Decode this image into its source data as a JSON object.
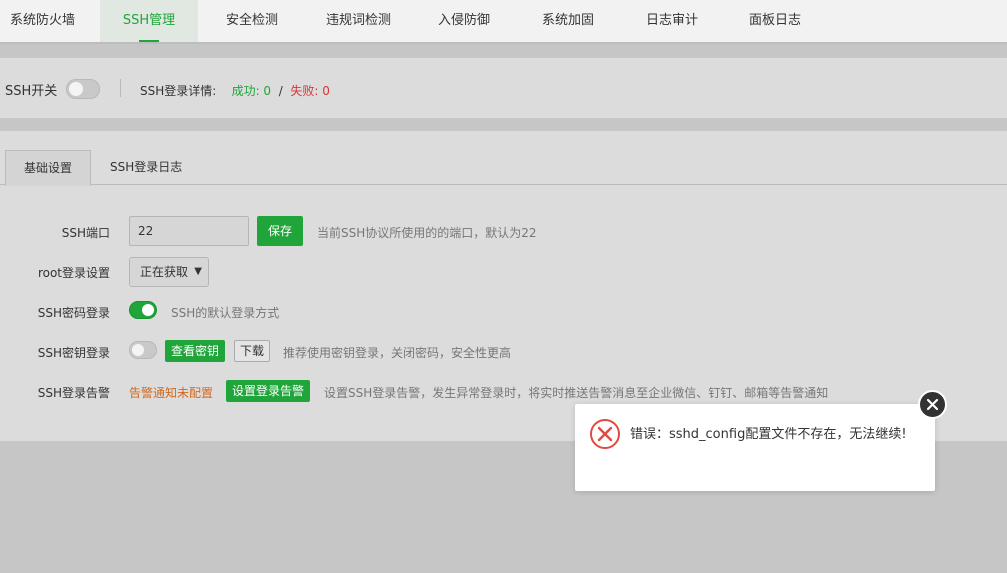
{
  "nav": {
    "tabs": [
      {
        "label": "系统防火墙"
      },
      {
        "label": "SSH管理",
        "active": true
      },
      {
        "label": "安全检测"
      },
      {
        "label": "违规词检测"
      },
      {
        "label": "入侵防御"
      },
      {
        "label": "系统加固"
      },
      {
        "label": "日志审计"
      },
      {
        "label": "面板日志"
      }
    ]
  },
  "ssh_switch": {
    "label": "SSH开关",
    "enabled": false,
    "detail_label": "SSH登录详情:",
    "success_label": "成功: 0",
    "separator": "/",
    "fail_label": "失败: 0"
  },
  "subtabs": [
    "基础设置",
    "SSH登录日志"
  ],
  "settings": {
    "port": {
      "label": "SSH端口",
      "value": "22",
      "save_label": "保存",
      "hint": "当前SSH协议所使用的的端口，默认为22"
    },
    "root_login": {
      "label": "root登录设置",
      "selected": "正在获取"
    },
    "password_login": {
      "label": "SSH密码登录",
      "enabled": true,
      "hint": "SSH的默认登录方式"
    },
    "key_login": {
      "label": "SSH密钥登录",
      "enabled": false,
      "view_key_label": "查看密钥",
      "download_label": "下载",
      "hint": "推荐使用密钥登录，关闭密码，安全性更高"
    },
    "login_alert": {
      "label": "SSH登录告警",
      "status": "告警通知未配置",
      "config_label": "设置登录告警",
      "hint": "设置SSH登录告警，发生异常登录时，将实时推送告警消息至企业微信、钉钉、邮箱等告警通知"
    }
  },
  "dialog": {
    "message": "错误：sshd_config配置文件不存在，无法继续!"
  },
  "colors": {
    "accent": "#20a53a",
    "error": "#e04a3f",
    "warning": "#d2691e"
  }
}
